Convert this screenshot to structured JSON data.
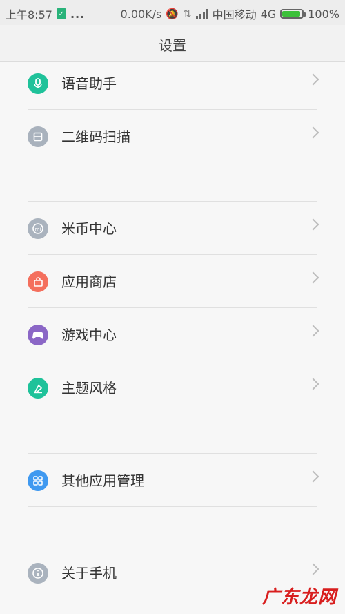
{
  "status_bar": {
    "time": "上午8:57",
    "dots": "...",
    "speed": "0.00K/s",
    "carrier": "中国移动",
    "network": "4G",
    "battery": "100%",
    "battery_level": 1.0
  },
  "header": {
    "title": "设置"
  },
  "colors": {
    "voice": "#1fc29a",
    "qr": "#a9b2bd",
    "mi": "#aab3be",
    "store": "#f46f5d",
    "game": "#8b67c6",
    "theme": "#1fc29a",
    "apps": "#3f99f0",
    "about": "#aab3be"
  },
  "groups": [
    {
      "items": [
        {
          "label": "语音助手",
          "icon": "microphone-icon"
        },
        {
          "label": "二维码扫描",
          "icon": "qr-scan-icon"
        }
      ]
    },
    {
      "items": [
        {
          "label": "米币中心",
          "icon": "mi-coin-icon"
        },
        {
          "label": "应用商店",
          "icon": "shopping-bag-icon"
        },
        {
          "label": "游戏中心",
          "icon": "gamepad-icon"
        },
        {
          "label": "主题风格",
          "icon": "brush-icon"
        }
      ]
    },
    {
      "items": [
        {
          "label": "其他应用管理",
          "icon": "grid-icon"
        }
      ]
    },
    {
      "items": [
        {
          "label": "关于手机",
          "icon": "info-icon"
        }
      ]
    }
  ],
  "watermark": "广东龙网"
}
